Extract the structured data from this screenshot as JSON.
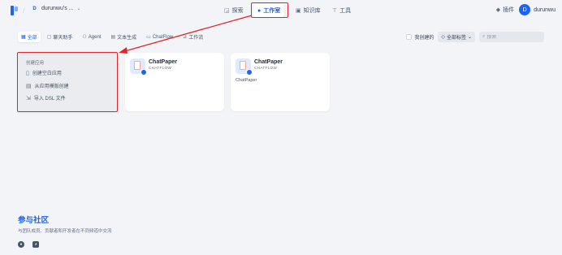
{
  "workspace": {
    "avatar_letter": "D",
    "name": "durunwu's ..."
  },
  "nav": {
    "explore": "探索",
    "studio": "工作室",
    "knowledge": "知识库",
    "tools": "工具"
  },
  "header_right": {
    "plugins": "插件",
    "user_letter": "D",
    "user_name": "durunwu"
  },
  "filters": {
    "tabs": [
      "全部",
      "聊天助手",
      "Agent",
      "文本生成",
      "ChatFlow",
      "工作流"
    ],
    "my_created": "我创建的",
    "all_tags": "全部标签",
    "search_placeholder": "搜索"
  },
  "create": {
    "title": "创建应用",
    "blank": "创建空白应用",
    "from_template": "从应用模版创建",
    "import_dsl": "导入 DSL 文件"
  },
  "apps": [
    {
      "name": "ChatPaper",
      "type": "CHATFLOW",
      "description": ""
    },
    {
      "name": "ChatPaper",
      "type": "CHATFLOW",
      "description": "ChatPaper"
    }
  ],
  "community": {
    "title": "参与社区",
    "subtitle": "与团队成员、贡献者和开发者在不同频道中交流"
  },
  "colors": {
    "accent": "#155eef",
    "annotation": "#e3242b"
  }
}
